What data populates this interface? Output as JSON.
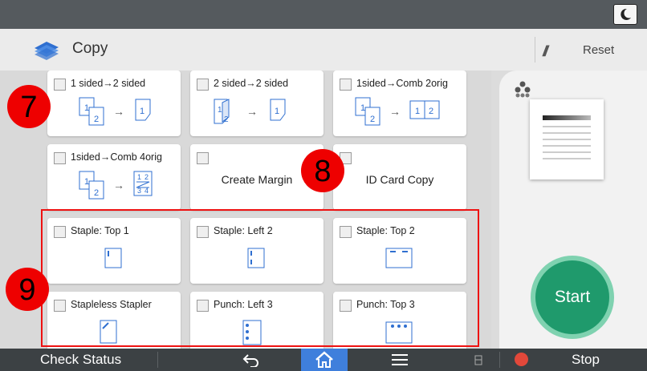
{
  "header": {
    "title": "Copy",
    "reset_label": "Reset"
  },
  "tiles": [
    {
      "label": "1 sided→2 sided"
    },
    {
      "label": "2 sided→2 sided"
    },
    {
      "label": "1sided→Comb 2orig"
    },
    {
      "label": "1sided→Comb 4orig"
    },
    {
      "label": "Create Margin"
    },
    {
      "label": "ID Card Copy"
    },
    {
      "label": "Staple: Top 1"
    },
    {
      "label": "Staple: Left 2"
    },
    {
      "label": "Staple: Top 2"
    },
    {
      "label": "Stapleless Stapler"
    },
    {
      "label": "Punch: Left 3"
    },
    {
      "label": "Punch: Top 3"
    }
  ],
  "illustrations": {
    "t1": {
      "src_a": "1",
      "src_b": "2",
      "dst": "1"
    },
    "t2": {
      "src_a": "1",
      "src_b": "2",
      "dst": "1"
    },
    "t3": {
      "src_a": "1",
      "src_b": "2",
      "dst_a": "1",
      "dst_b": "2"
    },
    "t4": {
      "src_a": "1",
      "src_b": "2",
      "dst_a": "1",
      "dst_b": "2",
      "dst_c": "3",
      "dst_d": "4"
    }
  },
  "start_label": "Start",
  "bottom": {
    "check_status": "Check Status",
    "stop_label": "Stop"
  },
  "callouts": [
    "7",
    "8",
    "9"
  ],
  "colors": {
    "start": "#1f9a6c",
    "home_bg": "#3f7fdc",
    "callout": "#ee0000",
    "topbar": "#555a5e"
  }
}
